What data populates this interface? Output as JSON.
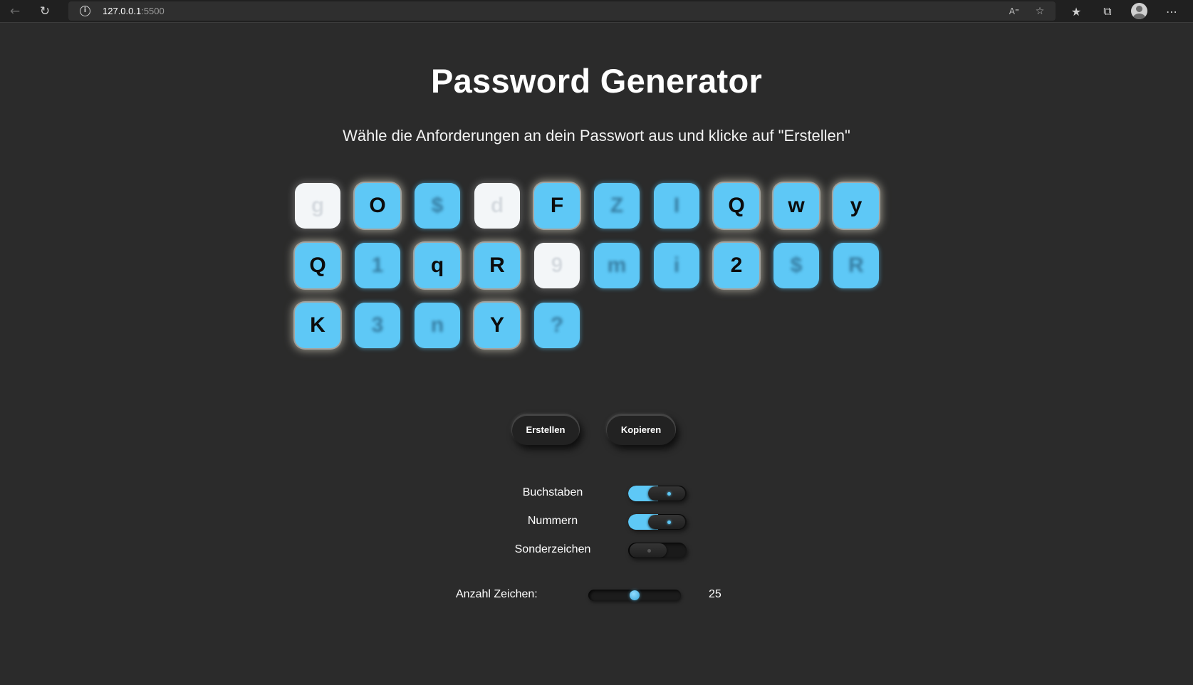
{
  "browser": {
    "url_host": "127.0.0.1",
    "url_port": ":5500"
  },
  "page": {
    "title": "Password Generator",
    "subtitle": "Wähle die Anforderungen an dein Passwort aus und klicke auf \"Erstellen\""
  },
  "keys": [
    {
      "char": "g",
      "style": "white"
    },
    {
      "char": "O",
      "style": "lit"
    },
    {
      "char": "$",
      "style": "blur"
    },
    {
      "char": "d",
      "style": "white"
    },
    {
      "char": "F",
      "style": "lit"
    },
    {
      "char": "Z",
      "style": "blur"
    },
    {
      "char": "I",
      "style": "blur"
    },
    {
      "char": "Q",
      "style": "lit"
    },
    {
      "char": "w",
      "style": "lit"
    },
    {
      "char": "y",
      "style": "lit"
    },
    {
      "char": "Q",
      "style": "lit"
    },
    {
      "char": "1",
      "style": "blur"
    },
    {
      "char": "q",
      "style": "lit"
    },
    {
      "char": "R",
      "style": "lit"
    },
    {
      "char": "9",
      "style": "white"
    },
    {
      "char": "m",
      "style": "blur"
    },
    {
      "char": "i",
      "style": "blur"
    },
    {
      "char": "2",
      "style": "lit"
    },
    {
      "char": "$",
      "style": "blur"
    },
    {
      "char": "R",
      "style": "blur"
    },
    {
      "char": "K",
      "style": "lit"
    },
    {
      "char": "3",
      "style": "blur"
    },
    {
      "char": "n",
      "style": "blur"
    },
    {
      "char": "Y",
      "style": "lit"
    },
    {
      "char": "?",
      "style": "blur"
    }
  ],
  "buttons": {
    "create": "Erstellen",
    "copy": "Kopieren"
  },
  "options": [
    {
      "label": "Buchstaben",
      "enabled": true
    },
    {
      "label": "Nummern",
      "enabled": true
    },
    {
      "label": "Sonderzeichen",
      "enabled": false
    }
  ],
  "length": {
    "label": "Anzahl Zeichen:",
    "value": "25",
    "fraction": 0.5
  },
  "colors": {
    "background": "#2b2b2b",
    "accent": "#5ec8f6"
  }
}
